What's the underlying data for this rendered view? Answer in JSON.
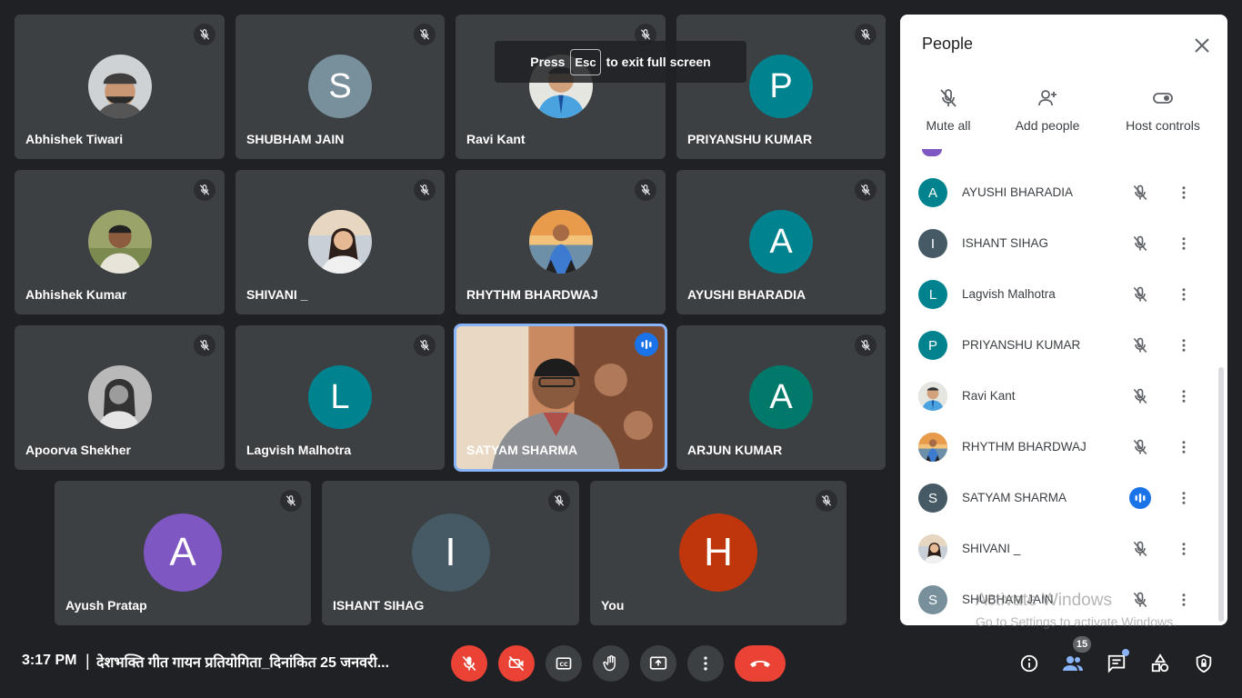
{
  "fullscreen_hint": {
    "press": "Press",
    "key": "Esc",
    "suffix": "to exit full screen"
  },
  "tiles": [
    {
      "name": "Abhishek Tiwari",
      "kind": "photo",
      "photo": "beanie-man",
      "muted": true
    },
    {
      "name": "SHUBHAM JAIN",
      "kind": "letter",
      "letter": "S",
      "color": "#78909c",
      "muted": true
    },
    {
      "name": "Ravi Kant",
      "kind": "photo",
      "photo": "man-shirt-blue",
      "muted": true
    },
    {
      "name": "PRIYANSHU KUMAR",
      "kind": "letter",
      "letter": "P",
      "color": "#00838f",
      "muted": true
    },
    {
      "name": "Abhishek Kumar",
      "kind": "photo",
      "photo": "man-outdoor",
      "muted": true
    },
    {
      "name": "SHIVANI _",
      "kind": "photo",
      "photo": "woman-selfie",
      "muted": true
    },
    {
      "name": "RHYTHM BHARDWAJ",
      "kind": "photo",
      "photo": "man-sunset",
      "muted": true
    },
    {
      "name": "AYUSHI BHARADIA",
      "kind": "letter",
      "letter": "A",
      "color": "#00838f",
      "muted": true
    },
    {
      "name": "Apoorva Shekher",
      "kind": "photo",
      "photo": "woman-bw",
      "muted": true
    },
    {
      "name": "Lagvish Malhotra",
      "kind": "letter",
      "letter": "L",
      "color": "#00838f",
      "muted": true
    },
    {
      "name": "SATYAM SHARMA",
      "kind": "video",
      "muted": false,
      "speaking": true
    },
    {
      "name": "ARJUN KUMAR",
      "kind": "letter",
      "letter": "A",
      "color": "#00796b",
      "muted": true
    },
    {
      "name": "Ayush Pratap",
      "kind": "letter",
      "letter": "A",
      "color": "#7e57c2",
      "muted": true
    },
    {
      "name": "ISHANT SIHAG",
      "kind": "letter",
      "letter": "I",
      "color": "#455a64",
      "muted": true
    },
    {
      "name": "You",
      "kind": "letter",
      "letter": "H",
      "color": "#bf360c",
      "muted": true
    }
  ],
  "panel": {
    "title": "People",
    "actions": [
      {
        "label": "Mute all",
        "icon": "mic-off-icon"
      },
      {
        "label": "Add people",
        "icon": "person-add-icon"
      },
      {
        "label": "Host controls",
        "icon": "toggle-icon"
      }
    ],
    "people": [
      {
        "name": "AYUSHI BHARADIA",
        "letter": "A",
        "color": "#00838f",
        "kind": "letter",
        "speaking": false
      },
      {
        "name": "ISHANT SIHAG",
        "letter": "I",
        "color": "#455a64",
        "kind": "letter",
        "speaking": false
      },
      {
        "name": "Lagvish Malhotra",
        "letter": "L",
        "color": "#00838f",
        "kind": "letter",
        "speaking": false
      },
      {
        "name": "PRIYANSHU KUMAR",
        "letter": "P",
        "color": "#00838f",
        "kind": "letter",
        "speaking": false
      },
      {
        "name": "Ravi Kant",
        "letter": "",
        "color": "#cfd8dc",
        "kind": "photo",
        "speaking": false
      },
      {
        "name": "RHYTHM BHARDWAJ",
        "letter": "",
        "color": "#8d6e63",
        "kind": "photo",
        "speaking": false
      },
      {
        "name": "SATYAM SHARMA",
        "letter": "S",
        "color": "#455a64",
        "kind": "letter",
        "speaking": true
      },
      {
        "name": "SHIVANI _",
        "letter": "",
        "color": "#e0e0e0",
        "kind": "photo",
        "speaking": false
      },
      {
        "name": "SHUBHAM JAIN",
        "letter": "S",
        "color": "#78909c",
        "kind": "letter",
        "speaking": false
      }
    ]
  },
  "watermark": {
    "line1": "Activate Windows",
    "line2": "Go to Settings to activate Windows."
  },
  "bottom": {
    "time": "3:17 PM",
    "separator": "|",
    "meeting_title": "देशभक्ति गीत गायन प्रतियोगिता_दिनांकित 25 जनवरी...",
    "participant_count": "15"
  },
  "colors": {
    "background": "#202124",
    "tile": "#3c4043",
    "danger": "#ea4335",
    "accent": "#1a73e8",
    "speaking_outline": "#8ab4f8"
  }
}
